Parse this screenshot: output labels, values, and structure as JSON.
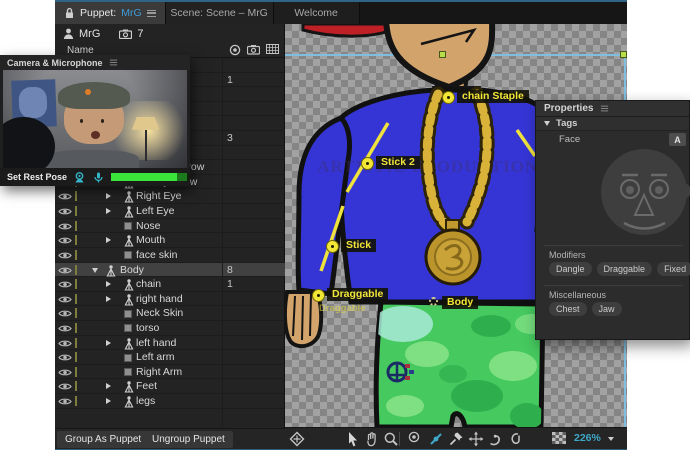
{
  "colors": {
    "accent_blue": "#3f9bd8",
    "selection_green": "#b8dc4a",
    "tag_yellow": "#f2e636",
    "meter_green": "#39e639",
    "focus_border": "#2e5d7d"
  },
  "tabs": {
    "puppet_prefix": "Puppet:",
    "puppet_name": "MrG",
    "scene": "Scene: Scene – MrG",
    "welcome": "Welcome"
  },
  "puppet_panel": {
    "puppet_name": "MrG",
    "camera_count": "7",
    "name_header": "Name",
    "header_icons": [
      "record-dot-icon",
      "camera-icon",
      "grid-icon"
    ],
    "rows": [
      {
        "label": "",
        "count": "",
        "icon": null,
        "arrow": null,
        "indent": 2
      },
      {
        "label": "",
        "count": "1",
        "icon": null,
        "arrow": null,
        "indent": 2
      },
      {
        "label": "",
        "count": "",
        "icon": null,
        "arrow": null,
        "indent": 2
      },
      {
        "label": "",
        "count": "",
        "icon": null,
        "arrow": null,
        "indent": 2
      },
      {
        "label": "",
        "count": "",
        "icon": null,
        "arrow": null,
        "indent": 2
      },
      {
        "label": "",
        "count": "3",
        "icon": null,
        "arrow": null,
        "indent": 2
      },
      {
        "label": "",
        "count": "",
        "icon": null,
        "arrow": null,
        "indent": 2
      },
      {
        "label": "Right Eyebrow",
        "count": "",
        "icon": "puppet",
        "arrow": "right",
        "indent": 2
      },
      {
        "label": "Left Eyebrow",
        "count": "",
        "icon": "puppet",
        "arrow": "right",
        "indent": 2
      },
      {
        "label": "Right Eye",
        "count": "",
        "icon": "puppet",
        "arrow": "right",
        "indent": 2
      },
      {
        "label": "Left Eye",
        "count": "",
        "icon": "puppet",
        "arrow": "right",
        "indent": 2
      },
      {
        "label": "Nose",
        "count": "",
        "icon": "mesh",
        "arrow": null,
        "indent": 2
      },
      {
        "label": "Mouth",
        "count": "",
        "icon": "puppet",
        "arrow": "right",
        "indent": 2
      },
      {
        "label": "face skin",
        "count": "",
        "icon": "mesh",
        "arrow": null,
        "indent": 2
      },
      {
        "label": "Body",
        "count": "8",
        "icon": "puppet",
        "arrow": "down",
        "indent": 1,
        "selected": true
      },
      {
        "label": "chain",
        "count": "1",
        "icon": "puppet",
        "arrow": "right",
        "indent": 2
      },
      {
        "label": "right hand",
        "count": "",
        "icon": "puppet",
        "arrow": "right",
        "indent": 2
      },
      {
        "label": "Neck Skin",
        "count": "",
        "icon": "mesh",
        "arrow": null,
        "indent": 2
      },
      {
        "label": "torso",
        "count": "",
        "icon": "mesh",
        "arrow": null,
        "indent": 2
      },
      {
        "label": "left hand",
        "count": "",
        "icon": "puppet",
        "arrow": "right",
        "indent": 2
      },
      {
        "label": "Left arm",
        "count": "",
        "icon": "mesh",
        "arrow": null,
        "indent": 2
      },
      {
        "label": "Right Arm",
        "count": "",
        "icon": "mesh",
        "arrow": null,
        "indent": 2
      },
      {
        "label": "Feet",
        "count": "",
        "icon": "puppet",
        "arrow": "right",
        "indent": 2
      },
      {
        "label": "legs",
        "count": "",
        "icon": "puppet",
        "arrow": "right",
        "indent": 2
      }
    ],
    "group_button": "Group As Puppet",
    "ungroup_button": "Ungroup Puppet"
  },
  "webcam": {
    "title": "Camera & Microphone",
    "set_rest_pose": "Set Rest Pose",
    "icons": [
      "webcam-icon",
      "microphone-icon"
    ]
  },
  "canvas": {
    "watermark": "ARTISTIC PRODUCTIONS",
    "tags": {
      "chain_staple": "chain Staple",
      "stick2": "Stick 2",
      "stick": "Stick",
      "draggable": "Draggable",
      "draggable_ghost": "Draggable",
      "body": "Body"
    },
    "zoom_level": "226%",
    "toolbar_icons": [
      "transform-icon",
      "cursor-icon",
      "hand-icon",
      "zoom-lens-icon",
      "divider",
      "record-dot-icon",
      "stick-tool-icon",
      "pin-tool-icon",
      "drag-tool-icon",
      "hook-tool-icon",
      "dangle-tool-icon",
      "checker-swatch-icon"
    ]
  },
  "properties": {
    "title": "Properties",
    "tags_header": "Tags",
    "face_label": "Face",
    "face_badge": "A",
    "modifiers_header": "Modifiers",
    "modifier_tags": [
      "Dangle",
      "Draggable",
      "Fixed"
    ],
    "misc_header": "Miscellaneous",
    "misc_tags": [
      "Chest",
      "Jaw"
    ]
  }
}
